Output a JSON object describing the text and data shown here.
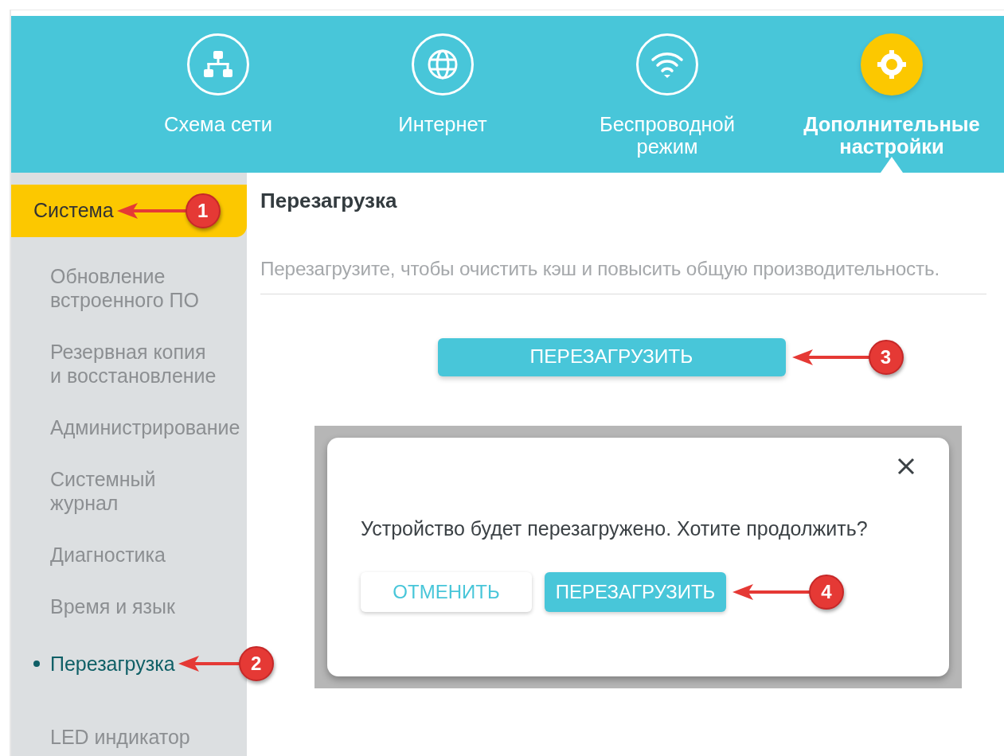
{
  "nav": [
    {
      "label": "Схема сети",
      "selected": false
    },
    {
      "label": "Интернет",
      "selected": false
    },
    {
      "label": "Беспроводной режим",
      "selected": false
    },
    {
      "label": "Дополнительные настройки",
      "selected": true
    }
  ],
  "sidebar": [
    {
      "label": "Система",
      "selected": true,
      "callout": "1",
      "children": [
        {
          "label": "Обновление встроенного ПО",
          "selected": false
        },
        {
          "label": "Резервная копия и восстановление",
          "selected": false
        },
        {
          "label": "Администрирование",
          "selected": false
        },
        {
          "label": "Системный журнал",
          "selected": false
        },
        {
          "label": "Диагностика",
          "selected": false
        },
        {
          "label": "Время и язык",
          "selected": false
        },
        {
          "label": "Перезагрузка",
          "selected": true,
          "callout": "2"
        },
        {
          "label": "LED индикатор",
          "selected": false
        }
      ]
    }
  ],
  "content": {
    "title": "Перезагрузка",
    "description": "Перезагрузите, чтобы очистить кэш и повысить общую производительность.",
    "button": {
      "label": "ПЕРЕЗАГРУЗИТЬ",
      "callout": "3"
    }
  },
  "dialog": {
    "message": "Устройство будет перезагружено. Хотите продолжить?",
    "buttons": [
      {
        "label": "ОТМЕНИТЬ",
        "kind": "secondary"
      },
      {
        "label": "ПЕРЕЗАГРУЗИТЬ",
        "kind": "primary",
        "callout": "4"
      }
    ]
  }
}
